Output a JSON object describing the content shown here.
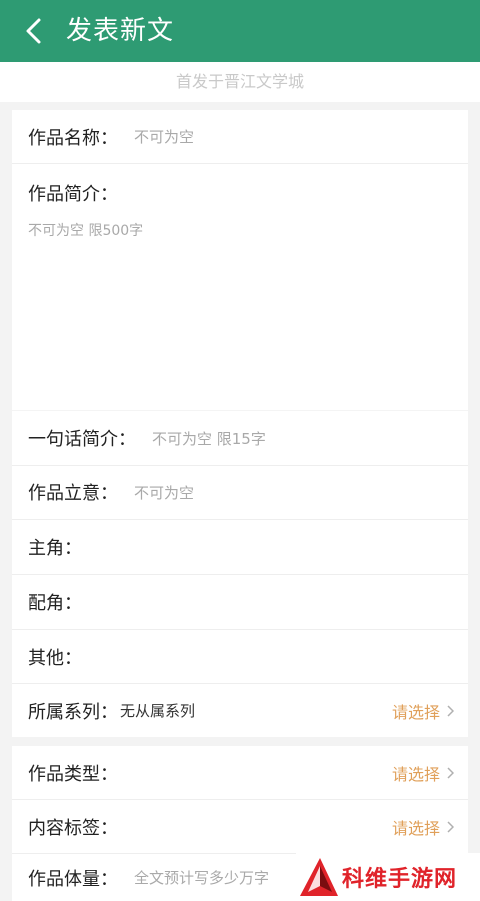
{
  "header": {
    "title": "发表新文",
    "colors": {
      "bar": "#2e9b73",
      "accent": "#e0a05a"
    }
  },
  "notice": "首发于晋江文学城",
  "form": {
    "name": {
      "label": "作品名称：",
      "placeholder": "不可为空"
    },
    "intro": {
      "label": "作品简介：",
      "placeholder": "不可为空 限500字"
    },
    "one_line": {
      "label": "一句话简介：",
      "placeholder": "不可为空 限15字"
    },
    "theme": {
      "label": "作品立意：",
      "placeholder": "不可为空"
    },
    "lead": {
      "label": "主角："
    },
    "support": {
      "label": "配角："
    },
    "other": {
      "label": "其他："
    },
    "series": {
      "label": "所属系列：",
      "value": "无从属系列",
      "action": "请选择"
    },
    "type": {
      "label": "作品类型：",
      "action": "请选择"
    },
    "tags": {
      "label": "内容标签：",
      "action": "请选择"
    },
    "volume": {
      "label": "作品体量：",
      "placeholder": "全文预计写多少万字"
    }
  },
  "watermark": {
    "text": "科维手游网"
  }
}
